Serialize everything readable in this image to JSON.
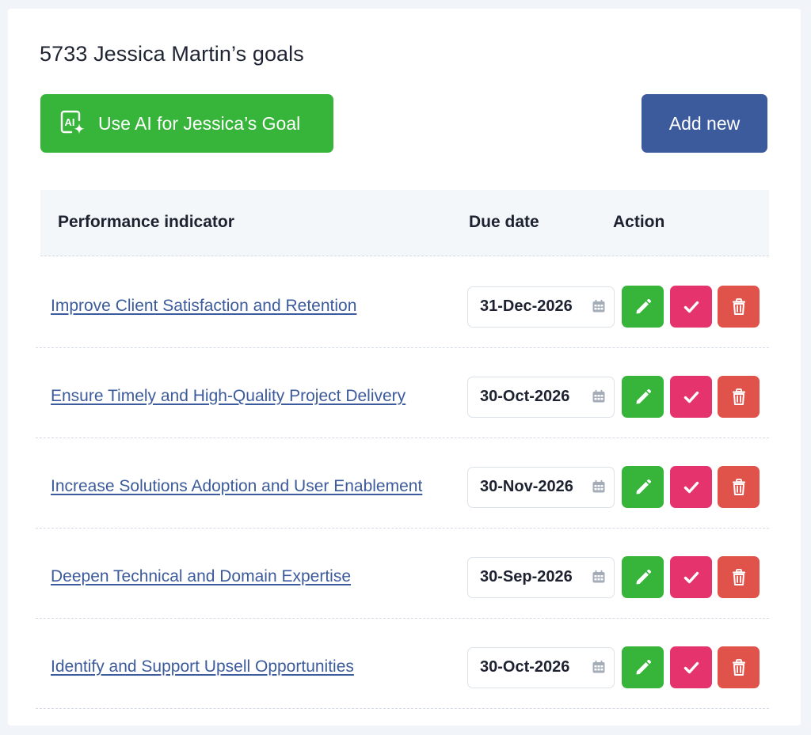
{
  "page": {
    "title": "5733 Jessica Martin’s goals"
  },
  "toolbar": {
    "ai_button_label": "Use AI for Jessica’s Goal",
    "ai_icon": "ai-sparkle-icon",
    "add_button_label": "Add new"
  },
  "table": {
    "columns": {
      "indicator": "Performance indicator",
      "due_date": "Due date",
      "action": "Action"
    },
    "rows": [
      {
        "indicator": "Improve Client Satisfaction and Retention",
        "due_date": "31-Dec-2026"
      },
      {
        "indicator": "Ensure Timely and High-Quality Project Delivery",
        "due_date": "30-Oct-2026"
      },
      {
        "indicator": "Increase Solutions Adoption and User Enablement",
        "due_date": "30-Nov-2026"
      },
      {
        "indicator": "Deepen Technical and Domain Expertise",
        "due_date": "30-Sep-2026"
      },
      {
        "indicator": "Identify and Support Upsell Opportunities",
        "due_date": "30-Oct-2026"
      }
    ]
  },
  "icons": {
    "date": "calendar-icon",
    "edit": "pencil-icon",
    "complete": "check-icon",
    "delete": "trash-icon"
  },
  "colors": {
    "ai_button": "#37b53a",
    "add_button": "#3c5b9c",
    "edit_button": "#37b53a",
    "complete_button": "#e5336d",
    "delete_button": "#e0534a",
    "link": "#3c5b9c"
  }
}
